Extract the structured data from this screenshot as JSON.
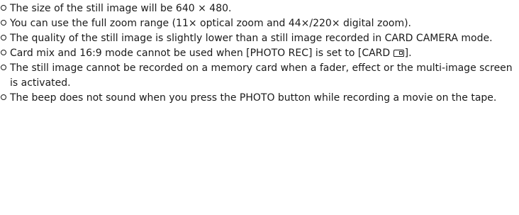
{
  "notes": [
    {
      "text": "The size of the still image will be 640 × 480."
    },
    {
      "text": "You can use the full zoom range (11× optical zoom and 44×/220× digital zoom)."
    },
    {
      "text": "The quality of the still image is slightly lower than a still image recorded in CARD CAMERA mode."
    },
    {
      "text_before": "Card mix and 16:9 mode cannot be used when [PHOTO REC] is set to [CARD ",
      "icon": "memory-card-icon",
      "text_after": "]."
    },
    {
      "text": "The still image cannot be recorded on a memory card when a fader, effect or the multi-image screen is activated."
    },
    {
      "text": "The beep does not sound when you press the PHOTO button while recording a movie on the tape."
    }
  ]
}
